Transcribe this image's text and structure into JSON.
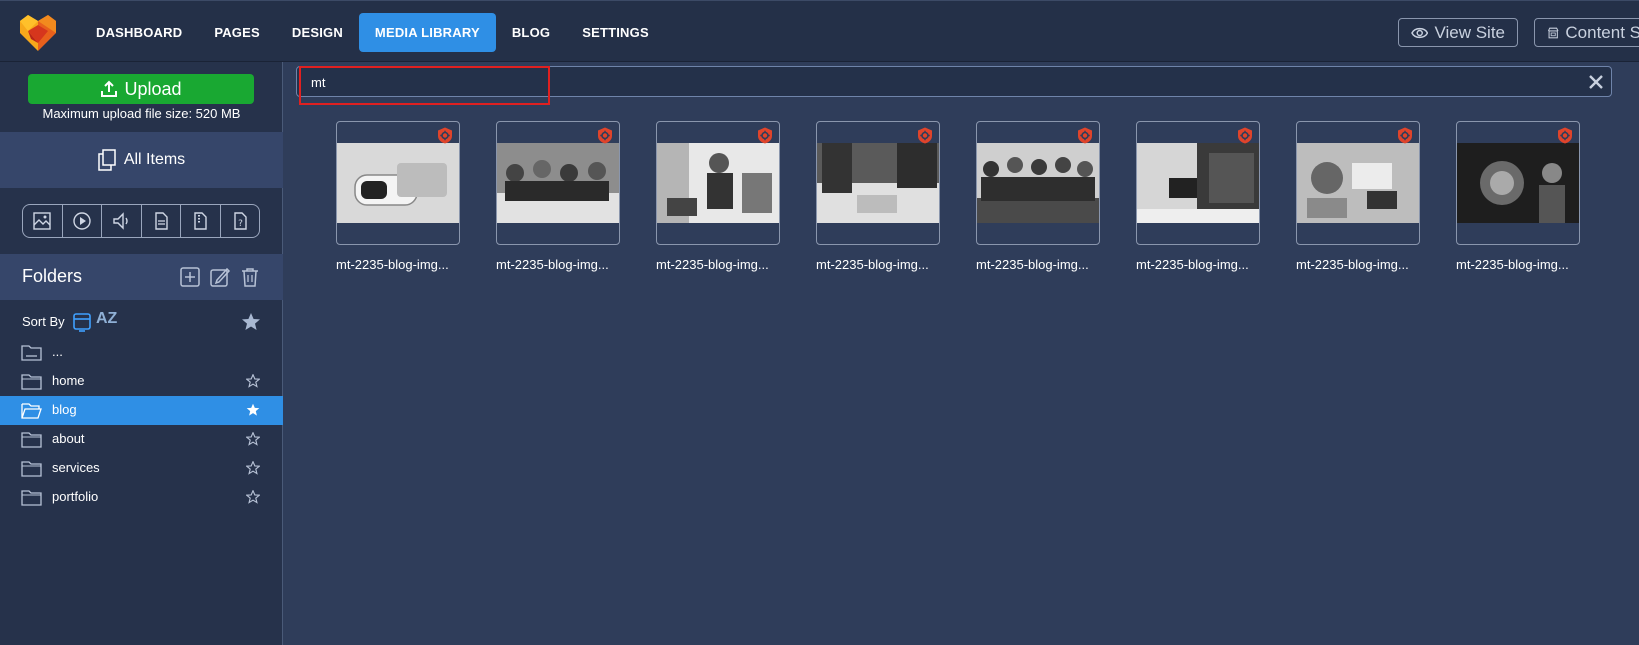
{
  "nav": {
    "items": [
      {
        "label": "DASHBOARD"
      },
      {
        "label": "PAGES"
      },
      {
        "label": "DESIGN"
      },
      {
        "label": "MEDIA LIBRARY",
        "active": true
      },
      {
        "label": "BLOG"
      },
      {
        "label": "SETTINGS"
      }
    ],
    "view_site": "View Site",
    "content": "Content S"
  },
  "sidebar": {
    "upload_label": "Upload",
    "upload_note": "Maximum upload file size: 520 MB",
    "all_items": "All Items",
    "filters": [
      "image-filter-icon",
      "video-filter-icon",
      "audio-filter-icon",
      "document-filter-icon",
      "archive-filter-icon",
      "other-filter-icon"
    ],
    "folders_title": "Folders",
    "sort_by": "Sort By",
    "sort_az": "AZ",
    "folders": [
      {
        "name": "...",
        "starred": null,
        "active": false
      },
      {
        "name": "home",
        "starred": false,
        "active": false
      },
      {
        "name": "blog",
        "starred": true,
        "active": true
      },
      {
        "name": "about",
        "starred": false,
        "active": false
      },
      {
        "name": "services",
        "starred": false,
        "active": false
      },
      {
        "name": "portfolio",
        "starred": false,
        "active": false
      }
    ]
  },
  "search": {
    "value": "mt"
  },
  "media": {
    "items": [
      {
        "label": "mt-2235-blog-img..."
      },
      {
        "label": "mt-2235-blog-img..."
      },
      {
        "label": "mt-2235-blog-img..."
      },
      {
        "label": "mt-2235-blog-img..."
      },
      {
        "label": "mt-2235-blog-img..."
      },
      {
        "label": "mt-2235-blog-img..."
      },
      {
        "label": "mt-2235-blog-img..."
      },
      {
        "label": "mt-2235-blog-img..."
      }
    ]
  },
  "colors": {
    "accent": "#2f8fe5",
    "upload": "#19a832",
    "badge": "#e0442b",
    "highlight": "#e02020"
  }
}
